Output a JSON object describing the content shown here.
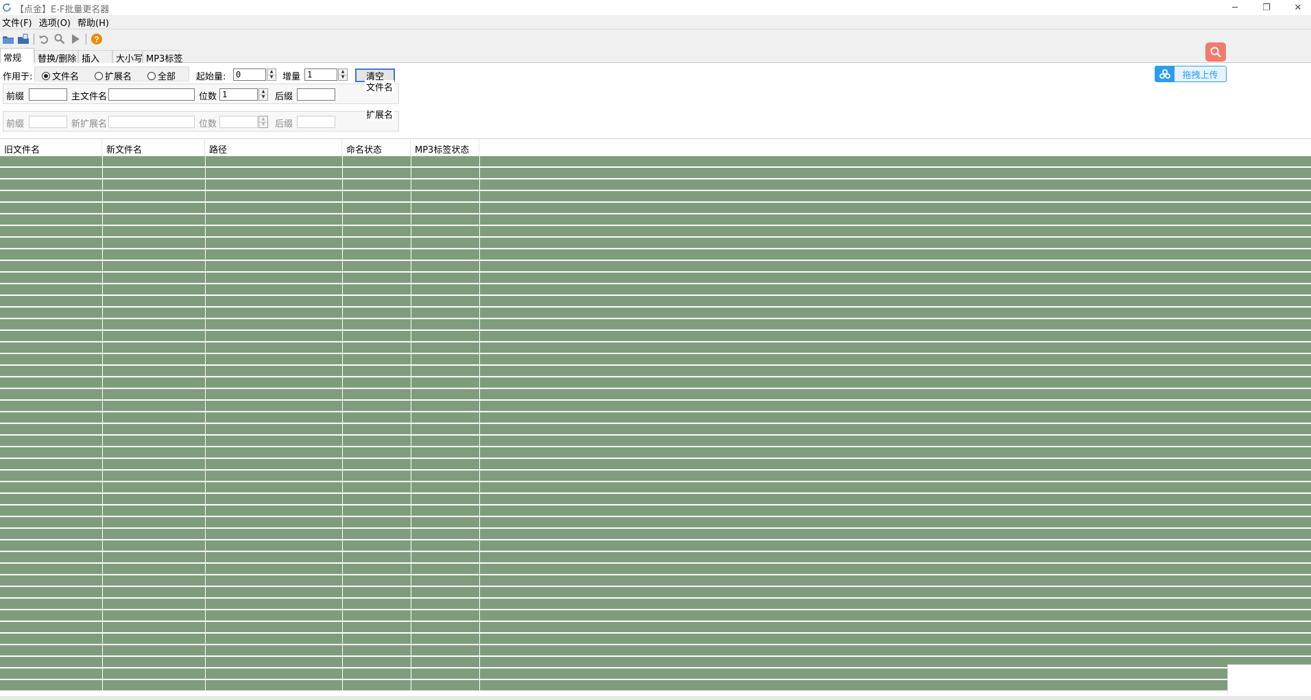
{
  "window": {
    "title": "【点金】E-F批量更名器",
    "minimize_glyph": "─",
    "maximize_glyph": "❐",
    "close_glyph": "✕"
  },
  "menu": [
    "文件(F)",
    "选项(O)",
    "帮助(H)"
  ],
  "toolbar": {
    "icons": [
      "open-folder-icon",
      "open-files-icon",
      "undo-icon",
      "search-icon",
      "run-icon",
      "help-icon"
    ]
  },
  "tabs": [
    "常规",
    "替换/删除",
    "插入",
    "大小写",
    "MP3标签"
  ],
  "general": {
    "apply_to_label": "作用于:",
    "radios": [
      {
        "label": "文件名",
        "checked": true
      },
      {
        "label": "扩展名",
        "checked": false
      },
      {
        "label": "全部",
        "checked": false
      }
    ],
    "start_label": "起始量:",
    "start_value": "0",
    "increment_label": "增量",
    "increment_value": "1",
    "clear_button": "清空",
    "filename_group": {
      "title": "文件名",
      "prefix_label": "前缀",
      "prefix_value": "",
      "main_label": "主文件名",
      "main_value": "",
      "digits_label": "位数",
      "digits_value": "1",
      "suffix_label": "后缀",
      "suffix_value": ""
    },
    "ext_group": {
      "title": "扩展名",
      "prefix_label": "前缀",
      "prefix_value": "",
      "main_label": "新扩展名",
      "main_value": "",
      "digits_label": "位数",
      "digits_value": "",
      "suffix_label": "后缀",
      "suffix_value": ""
    }
  },
  "widgets": {
    "upload_label": "拖拽上传"
  },
  "table": {
    "columns": [
      "旧文件名",
      "新文件名",
      "路径",
      "命名状态",
      "MP3标签状态"
    ],
    "row_color": "#7f9d7d",
    "rows": []
  },
  "colors": {
    "accent_blue": "#2d9cf0",
    "search_red": "#f07b6e",
    "row_green": "#7f9d7d"
  }
}
